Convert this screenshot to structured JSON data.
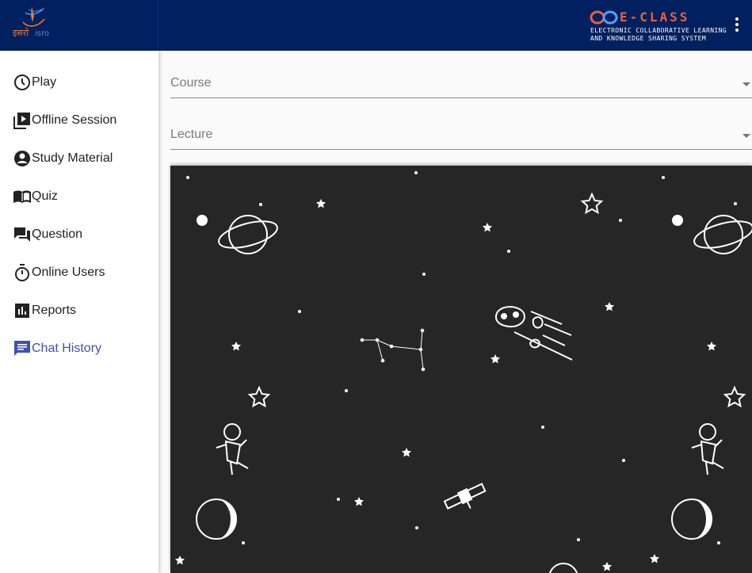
{
  "header": {
    "logo_name": "isro-logo",
    "logo_text_hindi": "इसरो",
    "logo_text_latin": "isro",
    "brand_title": "E-CLASS",
    "brand_subtitle_line1": "ELECTRONIC COLLABORATIVE LEARNING",
    "brand_subtitle_line2": "AND KNOWLEDGE SHARING SYSTEM",
    "menu_icon": "more-vert-icon"
  },
  "sidebar": {
    "items": [
      {
        "label": "Play",
        "icon": "clock-icon"
      },
      {
        "label": "Offline Session",
        "icon": "video-library-icon"
      },
      {
        "label": "Study Material",
        "icon": "account-circle-icon"
      },
      {
        "label": "Quiz",
        "icon": "open-book-icon"
      },
      {
        "label": "Question",
        "icon": "forum-icon"
      },
      {
        "label": "Online Users",
        "icon": "timer-icon"
      },
      {
        "label": "Reports",
        "icon": "bar-chart-icon"
      },
      {
        "label": "Chat History",
        "icon": "chat-icon",
        "active": true
      }
    ]
  },
  "filters": {
    "course_placeholder": "Course",
    "lecture_placeholder": "Lecture"
  },
  "colors": {
    "header_bg": "#012060",
    "brand_orange": "#e8623a",
    "active_nav": "#3f51b5",
    "space_bg": "#262626"
  }
}
